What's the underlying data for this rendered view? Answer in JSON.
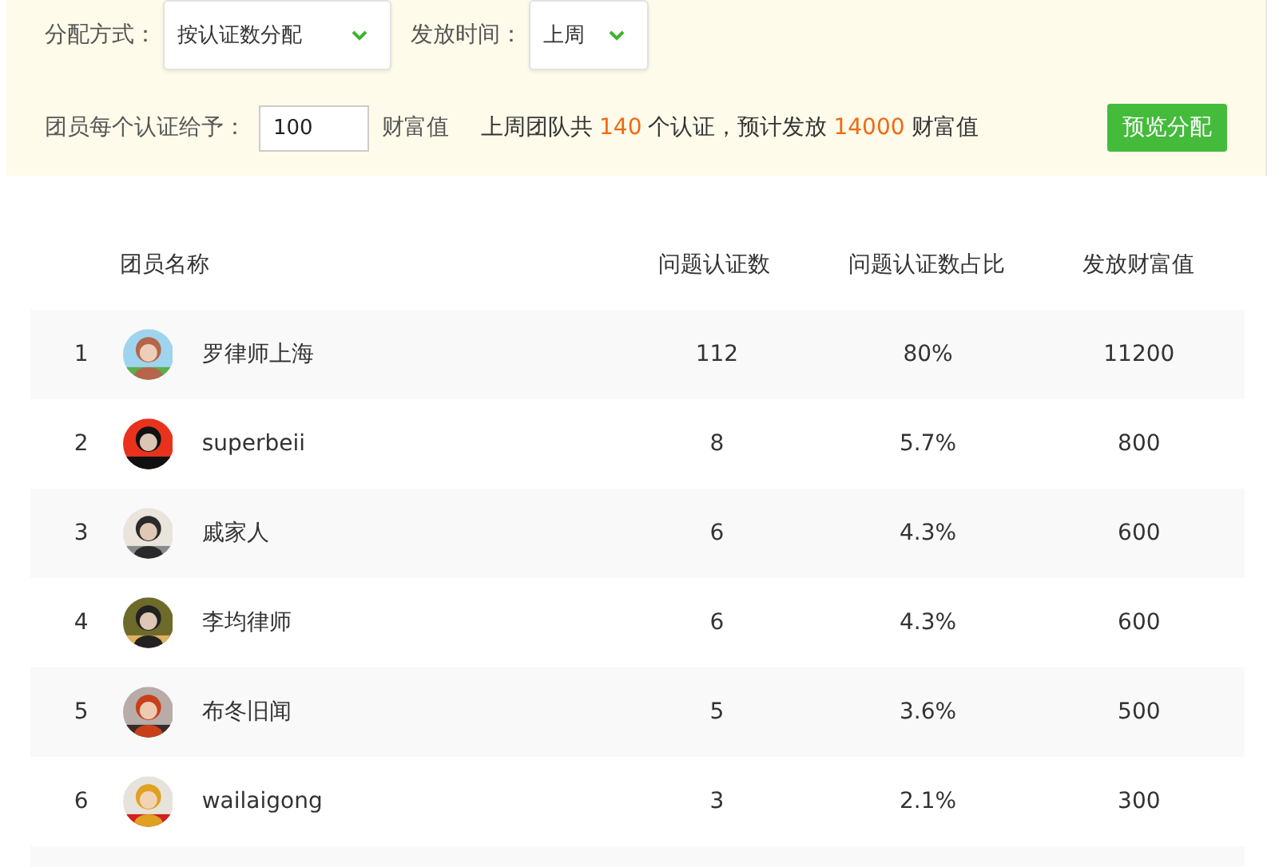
{
  "filters": {
    "method_label": "分配方式：",
    "method_value": "按认证数分配",
    "time_label": "发放时间：",
    "time_value": "上周"
  },
  "allocation": {
    "label": "团员每个认证给予：",
    "value": "100",
    "unit": "财富值",
    "summary": [
      {
        "kind": "text",
        "text": "上周团队共"
      },
      {
        "kind": "number",
        "text": "140"
      },
      {
        "kind": "text",
        "text": "个认证，预计发放"
      },
      {
        "kind": "number",
        "text": "14000"
      },
      {
        "kind": "text",
        "text": "财富值"
      }
    ],
    "button": "预览分配"
  },
  "table": {
    "columns": [
      "团员名称",
      "问题认证数",
      "问题认证数占比",
      "发放财富值"
    ],
    "rows": [
      {
        "rank": "1",
        "name": "罗律师上海",
        "count": "112",
        "share": "80%",
        "wealth": "11200"
      },
      {
        "rank": "2",
        "name": "superbeii",
        "count": "8",
        "share": "5.7%",
        "wealth": "800"
      },
      {
        "rank": "3",
        "name": "戚家人",
        "count": "6",
        "share": "4.3%",
        "wealth": "600"
      },
      {
        "rank": "4",
        "name": "李均律师",
        "count": "6",
        "share": "4.3%",
        "wealth": "600"
      },
      {
        "rank": "5",
        "name": "布冬旧闻",
        "count": "5",
        "share": "3.6%",
        "wealth": "500"
      },
      {
        "rank": "6",
        "name": "wailaigong",
        "count": "3",
        "share": "2.1%",
        "wealth": "300"
      }
    ]
  }
}
